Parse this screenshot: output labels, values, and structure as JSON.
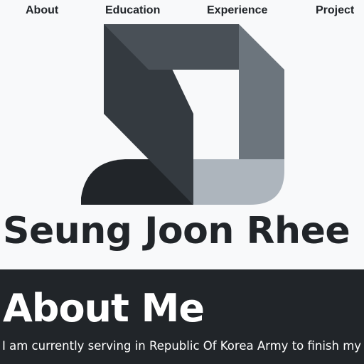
{
  "nav": {
    "items": [
      {
        "label": "About"
      },
      {
        "label": "Education"
      },
      {
        "label": "Experience"
      },
      {
        "label": "Project"
      }
    ]
  },
  "hero": {
    "logo_icon": "sj-monogram-logo",
    "name": "Seung Joon Rhee"
  },
  "about": {
    "title": "About Me",
    "text": "I am currently serving in Republic Of Korea Army to finish my co"
  },
  "colors": {
    "page_background": "#f8f9fa",
    "dark": "#212529",
    "logo_dark": "#343a40",
    "logo_mid": "#495057",
    "logo_gray": "#6c757d",
    "logo_light": "#adb5bd",
    "logo_lighter": "#ced4da"
  }
}
